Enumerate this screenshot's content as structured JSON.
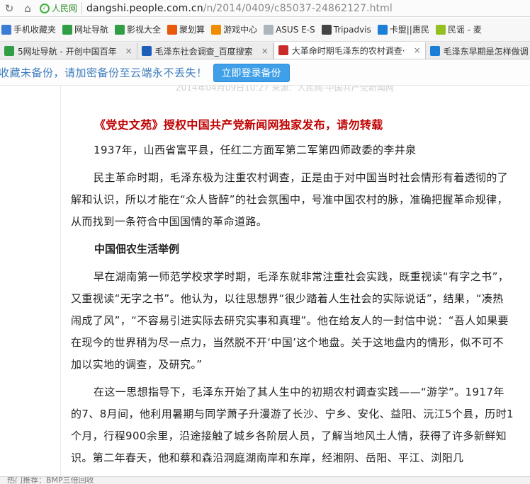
{
  "address_bar": {
    "site_tag": "人民网",
    "url_host": "dangshi.people.com.cn",
    "url_path": "/n/2014/0409/c85037-24862127.html"
  },
  "bookmarks": [
    {
      "label": "手机收藏夹",
      "icon": "phone-icon",
      "color": "#3a7bd5"
    },
    {
      "label": "网址导航",
      "icon": "home-icon",
      "color": "#2f9e44"
    },
    {
      "label": "影视大全",
      "icon": "film-icon",
      "color": "#2f9e44"
    },
    {
      "label": "聚划算",
      "icon": "ju-icon",
      "color": "#e8590c"
    },
    {
      "label": "游戏中心",
      "icon": "game-icon",
      "color": "#f08c00"
    },
    {
      "label": "ASUS E-S",
      "icon": "folder-icon",
      "color": "#adb5bd"
    },
    {
      "label": "Tripadvis",
      "icon": "owl-icon",
      "color": "#444444"
    },
    {
      "label": "卡盟||惠民",
      "icon": "card-icon",
      "color": "#1c7ed6"
    },
    {
      "label": "民谣 - 麦",
      "icon": "m-icon",
      "color": "#94c11f"
    }
  ],
  "tabs": [
    {
      "label": "5网址导航 - 开创中国百年",
      "active": false
    },
    {
      "label": "毛泽东社会调查_百度搜索",
      "active": false
    },
    {
      "label": "大革命时期毛泽东的农村调查·",
      "active": true
    },
    {
      "label": "毛泽东早期是怎样做调",
      "active": false
    }
  ],
  "notice": {
    "text": "收藏未备份，请加密备份至云端永不丢失！",
    "button": "立即登录备份"
  },
  "article": {
    "faded_top": "2014年04月09日10:27    来源：人民网-中国共产党新闻网",
    "headline": "《党史文苑》授权中国共产党新闻网独家发布，请勿转载",
    "caption": "1937年，山西省富平县，任红二方面军第二军第四师政委的李井泉",
    "para1": "民主革命时期，毛泽东极为注重农村调查，正是由于对中国当时社会情形有着透彻的了解和认识，所以才能在“众人皆醉”的社会氛围中，号准中国农村的脉，准确把握革命规律，从而找到一条符合中国国情的革命道路。",
    "subtitle": "中国佃农生活举例",
    "para2": "早在湖南第一师范学校求学时期，毛泽东就非常注重社会实践，既重视读“有字之书”，又重视读“无字之书”。他认为，以往思想界“很少踏着人生社会的实际说话”，结果，“凑热闹成了风”，“不容易引进实际去研究实事和真理”。他在给友人的一封信中说：“吾人如果要在现今的世界稍为尽一点力，当然脱不开‘中国’这个地盘。关于这地盘内的情形，似不可不加以实地的调查，及研究。”",
    "para3": "在这一思想指导下，毛泽东开始了其人生中的初期农村调查实践——“游学”。1917年的7、8月间，他利用暑期与同学萧子升漫游了长沙、宁乡、安化、益阳、沅江5个县，历时1个月，行程900余里，沿途接触了城乡各阶层人员，了解当地风土人情，获得了许多新鲜知识。第二年春天，他和蔡和森沿洞庭湖南岸和东岸，经湘阴、岳阳、平江、浏阳几"
  },
  "status_bar": "热门推荐：BMP三倍回收"
}
